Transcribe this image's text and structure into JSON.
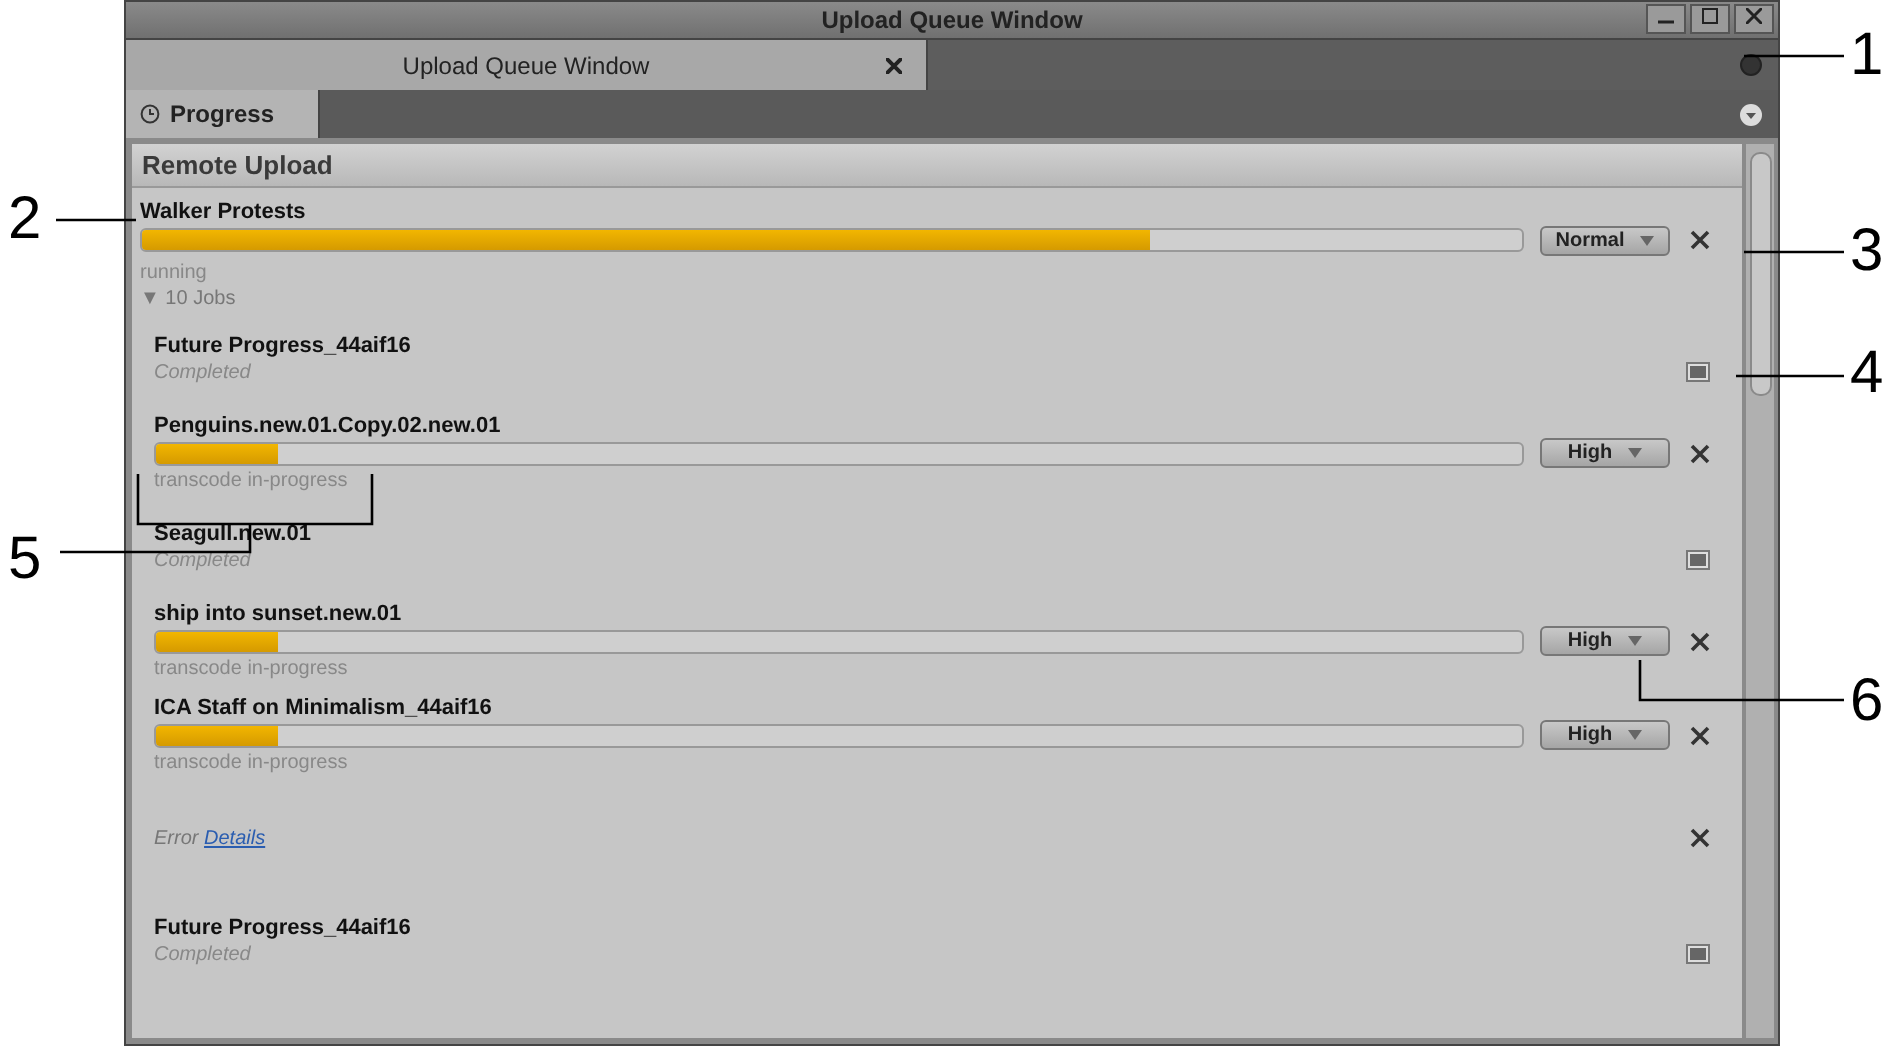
{
  "window": {
    "title": "Upload Queue Window"
  },
  "tabs": [
    {
      "label": "Upload Queue Window",
      "selected": true
    }
  ],
  "sub_tabs": [
    {
      "label": "Progress",
      "selected": true
    }
  ],
  "panel": {
    "title": "Remote Upload"
  },
  "group": {
    "name": "Walker Protests",
    "level": 0.73,
    "priority": "Normal",
    "status": "running",
    "jobs_toggle": "▼ 10 Jobs"
  },
  "jobs": [
    {
      "kind": "completed",
      "name": "Future Progress_44aif16",
      "status": "Completed"
    },
    {
      "kind": "progress",
      "name": "Penguins.new.01.Copy.02.new.01",
      "level": 0.09,
      "priority": "High",
      "status": "transcode in-progress"
    },
    {
      "kind": "completed",
      "name": "Seagull.new.01",
      "status": "Completed"
    },
    {
      "kind": "progress",
      "name": "ship into sunset.new.01",
      "level": 0.09,
      "priority": "High",
      "status": "transcode in-progress"
    },
    {
      "kind": "progress",
      "name": "ICA Staff on Minimalism_44aif16",
      "level": 0.09,
      "priority": "High",
      "status": "transcode in-progress"
    },
    {
      "kind": "error",
      "label": "Error",
      "link": "Details"
    },
    {
      "kind": "completed",
      "name": "Future Progress_44aif16",
      "status": "Completed"
    }
  ],
  "callouts": [
    "1",
    "2",
    "3",
    "4",
    "5",
    "6"
  ]
}
